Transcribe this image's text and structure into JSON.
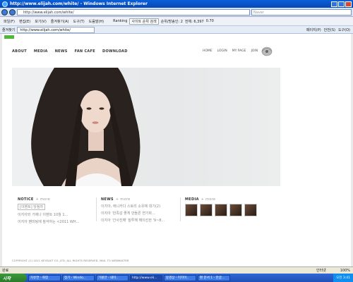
{
  "window": {
    "title": "http://www.elijah.com/white/ - Windows Internet Explorer"
  },
  "address": {
    "url": "http://www.elijah.com/white/",
    "search_placeholder": "Naver"
  },
  "menu": {
    "items": [
      "파일(F)",
      "편집(E)",
      "보기(V)",
      "즐겨찾기(A)",
      "도구(T)",
      "도움말(H)"
    ],
    "toolbar_ranking": "Ranking",
    "toolbar_search": "사이트 순위 검색",
    "toolbar_rank_label": "순위/방송인: 2",
    "toolbar_total": "전체: 6,397",
    "toolbar_score": "0.70"
  },
  "favbar": {
    "favorites": "즐겨찾기",
    "tab_url": "http://www.elijah.com/white/",
    "right_items": [
      "페이지(P)",
      "안전(S)",
      "도구(O)"
    ]
  },
  "site": {
    "nav": [
      "ABOUT",
      "MEDIA",
      "NEWS",
      "FAN CAFE",
      "DOWNLOAD"
    ],
    "util_nav": [
      "HOME",
      "LOGIN",
      "MY PAGE",
      "JOIN"
    ],
    "notice": {
      "title": "NOTICE",
      "more": "+ more",
      "lines": [
        "[이벤트] 당첨자",
        "이지아와 가제나 이벤트 10월 1...",
        "이지아 팬미팅에 참석하는 <2011 WH..."
      ]
    },
    "news": {
      "title": "NEWS",
      "more": "+ more",
      "lines": [
        "이지아, 애니카다 스토리 소유에 대기(2)",
        "이지아 '만족감 좋게 만들른 연기파...",
        "이지아 '간사진해' 질투해 해이킨한 '9~8..."
      ]
    },
    "media": {
      "title": "MEDIA",
      "more": "+ more"
    },
    "copyright": "COPYRIGHT (C) 2011 KEYEAST CO.,LTD. ALL RIGHTS RESERVED.  MAIL TO WEBMASTER"
  },
  "status": {
    "text": "완료",
    "zone": "인터넷",
    "zoom": "100%"
  },
  "taskbar": {
    "start": "시작",
    "tasks": [
      "자유연 - 화합",
      "정기 - Windo...",
      "가볼만 - 내이..",
      "http://www.eli...",
      "동영상 - 이지아..",
      "편 문서 1 - 한글..."
    ],
    "clock": "오전 3:41"
  }
}
